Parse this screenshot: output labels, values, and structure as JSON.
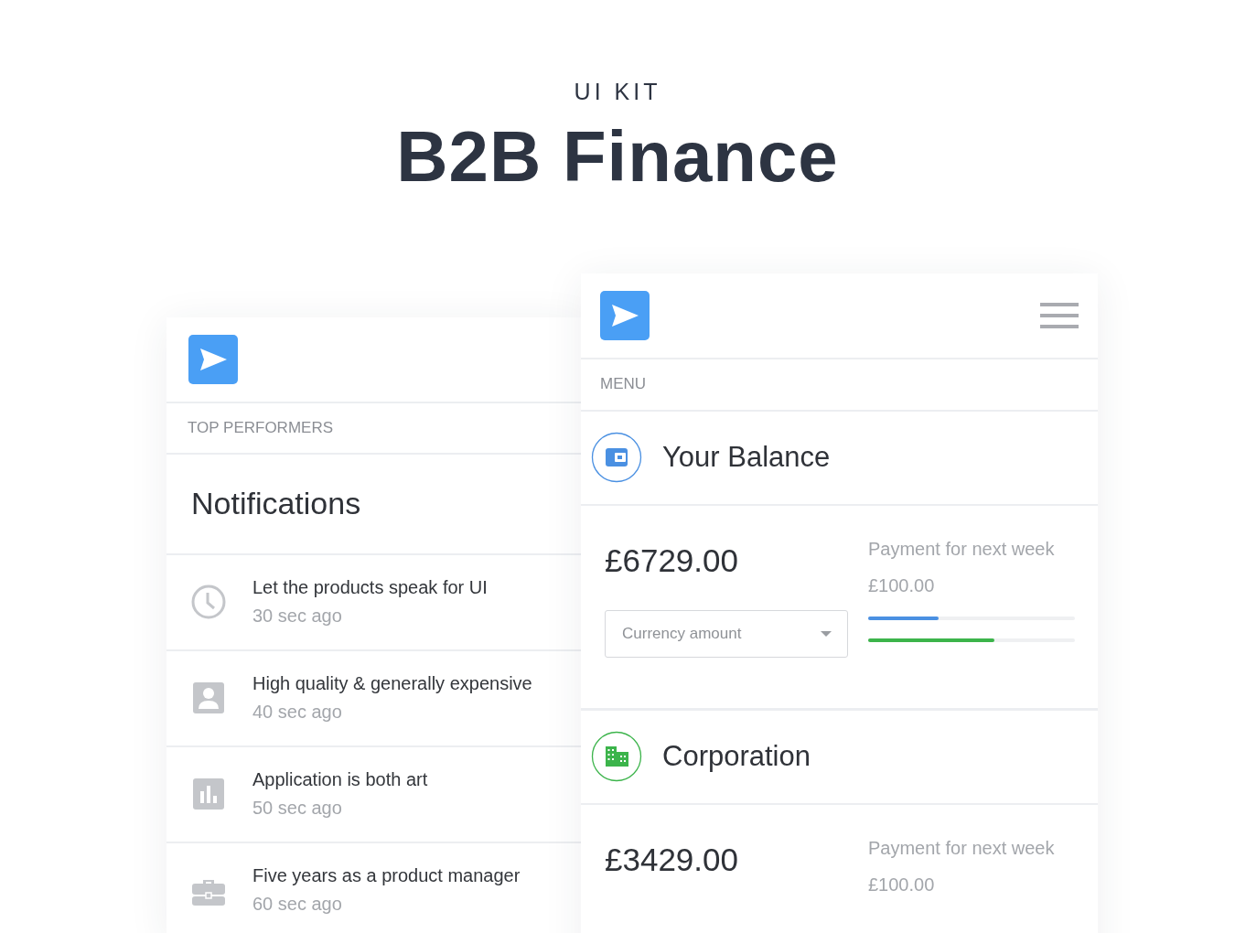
{
  "header": {
    "kicker": "UI KIT",
    "title": "B2B Finance"
  },
  "left_card": {
    "section_label": "TOP PERFORMERS",
    "title": "Notifications",
    "items": [
      {
        "kind": "clock",
        "text": "Let the products speak for UI",
        "time": "30 sec ago"
      },
      {
        "kind": "person",
        "text": "High quality & generally expensive",
        "time": "40 sec ago"
      },
      {
        "kind": "chart",
        "text": "Application is both art",
        "time": "50 sec ago"
      },
      {
        "kind": "briefcase",
        "text": "Five years as a product manager",
        "time": "60 sec ago"
      }
    ]
  },
  "right_card": {
    "section_label": "MENU",
    "accounts": [
      {
        "kind": "wallet",
        "color": "#4a90e2",
        "title": "Your Balance",
        "amount": "£6729.00",
        "payment_label": "Payment for next week",
        "payment_amount": "£100.00",
        "field": {
          "placeholder": "Currency amount"
        },
        "bars": [
          {
            "color": "#4a90e2",
            "level": 0.34
          },
          {
            "color": "#3cb44b",
            "level": 0.61
          }
        ]
      },
      {
        "kind": "building",
        "color": "#3cb44b",
        "title": "Corporation",
        "amount": "£3429.00",
        "payment_label": "Payment for next week",
        "payment_amount": "£100.00"
      }
    ]
  }
}
